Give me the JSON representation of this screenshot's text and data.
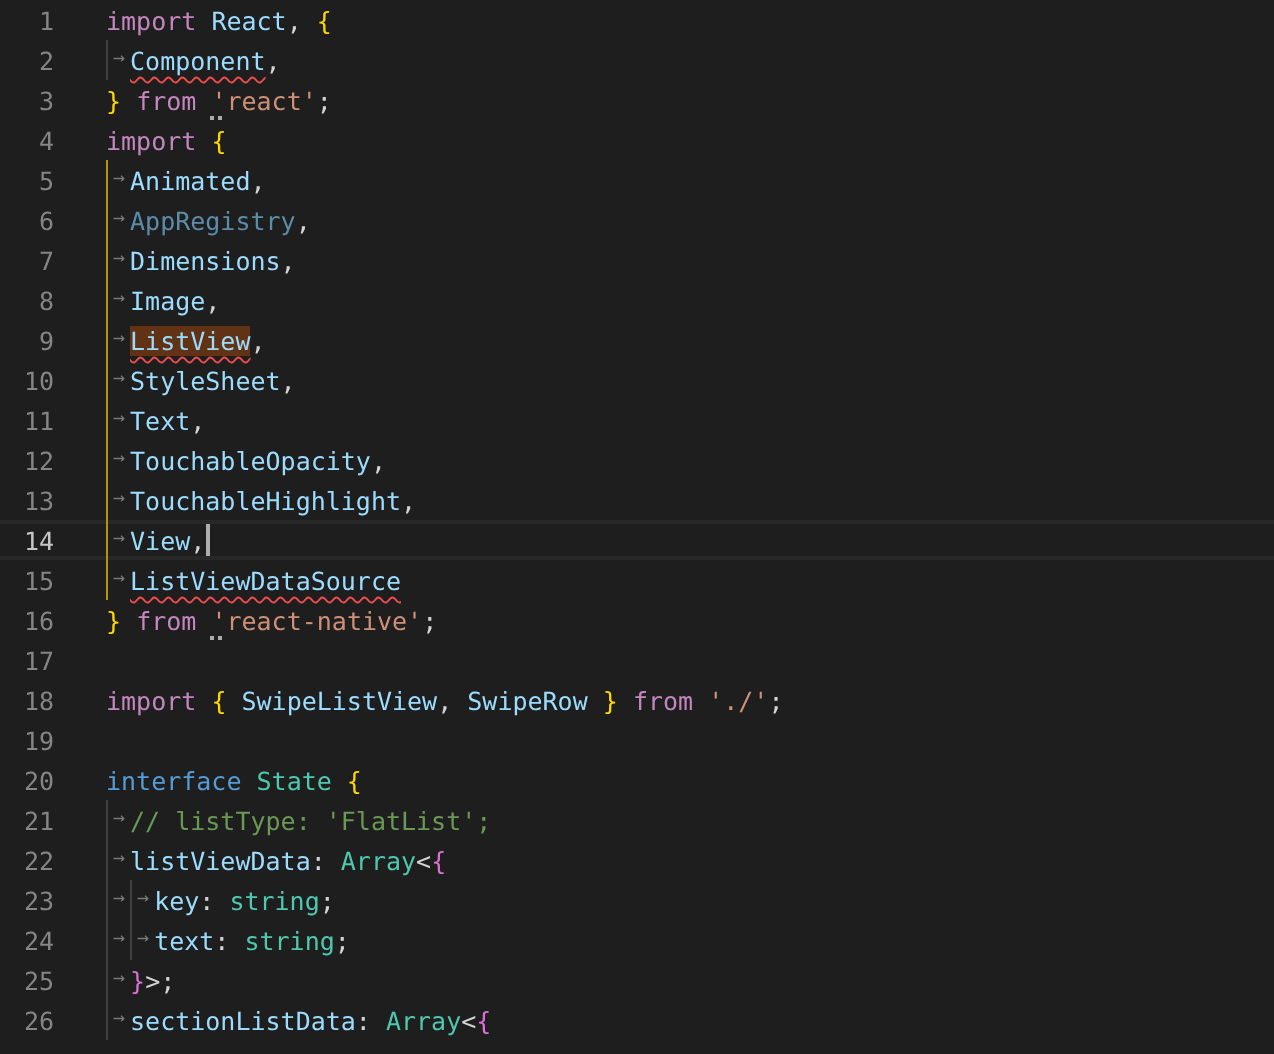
{
  "editor": {
    "lines": [
      {
        "number": "1",
        "current": false,
        "tokens": [
          {
            "kind": "control",
            "text": "import "
          },
          {
            "kind": "variable",
            "text": "React"
          },
          {
            "kind": "punct",
            "text": ", "
          },
          {
            "kind": "bracket1",
            "text": "{"
          }
        ]
      },
      {
        "number": "2",
        "current": false,
        "in_scope": false,
        "tokens": [
          {
            "kind": "tab",
            "text": "→"
          },
          {
            "kind": "variable",
            "text": "Component",
            "error": true
          },
          {
            "kind": "punct",
            "text": ","
          }
        ]
      },
      {
        "number": "3",
        "current": false,
        "tokens": [
          {
            "kind": "bracket1",
            "text": "} "
          },
          {
            "kind": "control",
            "text": "from "
          },
          {
            "kind": "string",
            "text": "'",
            "hint": true
          },
          {
            "kind": "string",
            "text": "react'"
          },
          {
            "kind": "punct",
            "text": ";"
          }
        ]
      },
      {
        "number": "4",
        "current": false,
        "tokens": [
          {
            "kind": "control",
            "text": "import "
          },
          {
            "kind": "bracket1",
            "text": "{"
          }
        ]
      },
      {
        "number": "5",
        "current": false,
        "in_scope": true,
        "tokens": [
          {
            "kind": "tab",
            "text": "→"
          },
          {
            "kind": "variable",
            "text": "Animated"
          },
          {
            "kind": "punct",
            "text": ","
          }
        ]
      },
      {
        "number": "6",
        "current": false,
        "in_scope": true,
        "tokens": [
          {
            "kind": "tab",
            "text": "→"
          },
          {
            "kind": "unused",
            "text": "AppRegistry"
          },
          {
            "kind": "punct",
            "text": ","
          }
        ]
      },
      {
        "number": "7",
        "current": false,
        "in_scope": true,
        "tokens": [
          {
            "kind": "tab",
            "text": "→"
          },
          {
            "kind": "variable",
            "text": "Dimensions"
          },
          {
            "kind": "punct",
            "text": ","
          }
        ]
      },
      {
        "number": "8",
        "current": false,
        "in_scope": true,
        "tokens": [
          {
            "kind": "tab",
            "text": "→"
          },
          {
            "kind": "variable",
            "text": "Image"
          },
          {
            "kind": "punct",
            "text": ","
          }
        ]
      },
      {
        "number": "9",
        "current": false,
        "in_scope": true,
        "tokens": [
          {
            "kind": "tab",
            "text": "→"
          },
          {
            "kind": "variable",
            "text": "ListView",
            "error": true,
            "highlighted": true
          },
          {
            "kind": "punct",
            "text": ","
          }
        ]
      },
      {
        "number": "10",
        "current": false,
        "in_scope": true,
        "tokens": [
          {
            "kind": "tab",
            "text": "→"
          },
          {
            "kind": "variable",
            "text": "StyleSheet"
          },
          {
            "kind": "punct",
            "text": ","
          }
        ]
      },
      {
        "number": "11",
        "current": false,
        "in_scope": true,
        "tokens": [
          {
            "kind": "tab",
            "text": "→"
          },
          {
            "kind": "variable",
            "text": "Text"
          },
          {
            "kind": "punct",
            "text": ","
          }
        ]
      },
      {
        "number": "12",
        "current": false,
        "in_scope": true,
        "tokens": [
          {
            "kind": "tab",
            "text": "→"
          },
          {
            "kind": "variable",
            "text": "TouchableOpacity"
          },
          {
            "kind": "punct",
            "text": ","
          }
        ]
      },
      {
        "number": "13",
        "current": false,
        "in_scope": true,
        "tokens": [
          {
            "kind": "tab",
            "text": "→"
          },
          {
            "kind": "variable",
            "text": "TouchableHighlight"
          },
          {
            "kind": "punct",
            "text": ","
          }
        ]
      },
      {
        "number": "14",
        "current": true,
        "in_scope": true,
        "tokens": [
          {
            "kind": "tab",
            "text": "→"
          },
          {
            "kind": "variable",
            "text": "View"
          },
          {
            "kind": "punct",
            "text": ","
          }
        ]
      },
      {
        "number": "15",
        "current": false,
        "in_scope": true,
        "tokens": [
          {
            "kind": "tab",
            "text": "→"
          },
          {
            "kind": "variable",
            "text": "ListViewDataSource",
            "error": true
          }
        ]
      },
      {
        "number": "16",
        "current": false,
        "tokens": [
          {
            "kind": "bracket1",
            "text": "} "
          },
          {
            "kind": "control",
            "text": "from "
          },
          {
            "kind": "string",
            "text": "'",
            "hint": true
          },
          {
            "kind": "string",
            "text": "react-native'"
          },
          {
            "kind": "punct",
            "text": ";"
          }
        ]
      },
      {
        "number": "17",
        "current": false
      },
      {
        "number": "18",
        "current": false,
        "tokens": [
          {
            "kind": "control",
            "text": "import "
          },
          {
            "kind": "bracket1",
            "text": "{ "
          },
          {
            "kind": "variable",
            "text": "SwipeListView"
          },
          {
            "kind": "punct",
            "text": ", "
          },
          {
            "kind": "variable",
            "text": "SwipeRow "
          },
          {
            "kind": "bracket1",
            "text": "} "
          },
          {
            "kind": "control",
            "text": "from "
          },
          {
            "kind": "string",
            "text": "'./'"
          },
          {
            "kind": "punct",
            "text": ";"
          }
        ]
      },
      {
        "number": "19",
        "current": false
      },
      {
        "number": "20",
        "current": false,
        "tokens": [
          {
            "kind": "storage",
            "text": "interface "
          },
          {
            "kind": "type",
            "text": "State "
          },
          {
            "kind": "bracket1",
            "text": "{"
          }
        ]
      },
      {
        "number": "21",
        "current": false,
        "in_scope": false,
        "tokens": [
          {
            "kind": "tab",
            "text": "→"
          },
          {
            "kind": "comment",
            "text": "// listType: 'FlatList';"
          }
        ]
      },
      {
        "number": "22",
        "current": false,
        "in_scope": false,
        "tokens": [
          {
            "kind": "tab",
            "text": "→"
          },
          {
            "kind": "variable",
            "text": "listViewData"
          },
          {
            "kind": "punct",
            "text": ": "
          },
          {
            "kind": "type",
            "text": "Array"
          },
          {
            "kind": "punct",
            "text": "<"
          },
          {
            "kind": "bracket2",
            "text": "{"
          }
        ]
      },
      {
        "number": "23",
        "current": false,
        "in_scope": false,
        "tokens": [
          {
            "kind": "tab",
            "text": "→"
          },
          {
            "kind": "tab",
            "text": "→"
          },
          {
            "kind": "variable",
            "text": "key"
          },
          {
            "kind": "punct",
            "text": ": "
          },
          {
            "kind": "type",
            "text": "string"
          },
          {
            "kind": "punct",
            "text": ";"
          }
        ]
      },
      {
        "number": "24",
        "current": false,
        "in_scope": false,
        "tokens": [
          {
            "kind": "tab",
            "text": "→"
          },
          {
            "kind": "tab",
            "text": "→"
          },
          {
            "kind": "variable",
            "text": "text"
          },
          {
            "kind": "punct",
            "text": ": "
          },
          {
            "kind": "type",
            "text": "string"
          },
          {
            "kind": "punct",
            "text": ";"
          }
        ]
      },
      {
        "number": "25",
        "current": false,
        "in_scope": false,
        "tokens": [
          {
            "kind": "tab",
            "text": "→"
          },
          {
            "kind": "bracket2",
            "text": "}"
          },
          {
            "kind": "punct",
            "text": ">;"
          }
        ]
      },
      {
        "number": "26",
        "current": false,
        "in_scope": false,
        "tokens": [
          {
            "kind": "tab",
            "text": "→"
          },
          {
            "kind": "variable",
            "text": "sectionListData"
          },
          {
            "kind": "punct",
            "text": ": "
          },
          {
            "kind": "type",
            "text": "Array"
          },
          {
            "kind": "punct",
            "text": "<"
          },
          {
            "kind": "bracket2",
            "text": "{"
          }
        ]
      }
    ]
  }
}
